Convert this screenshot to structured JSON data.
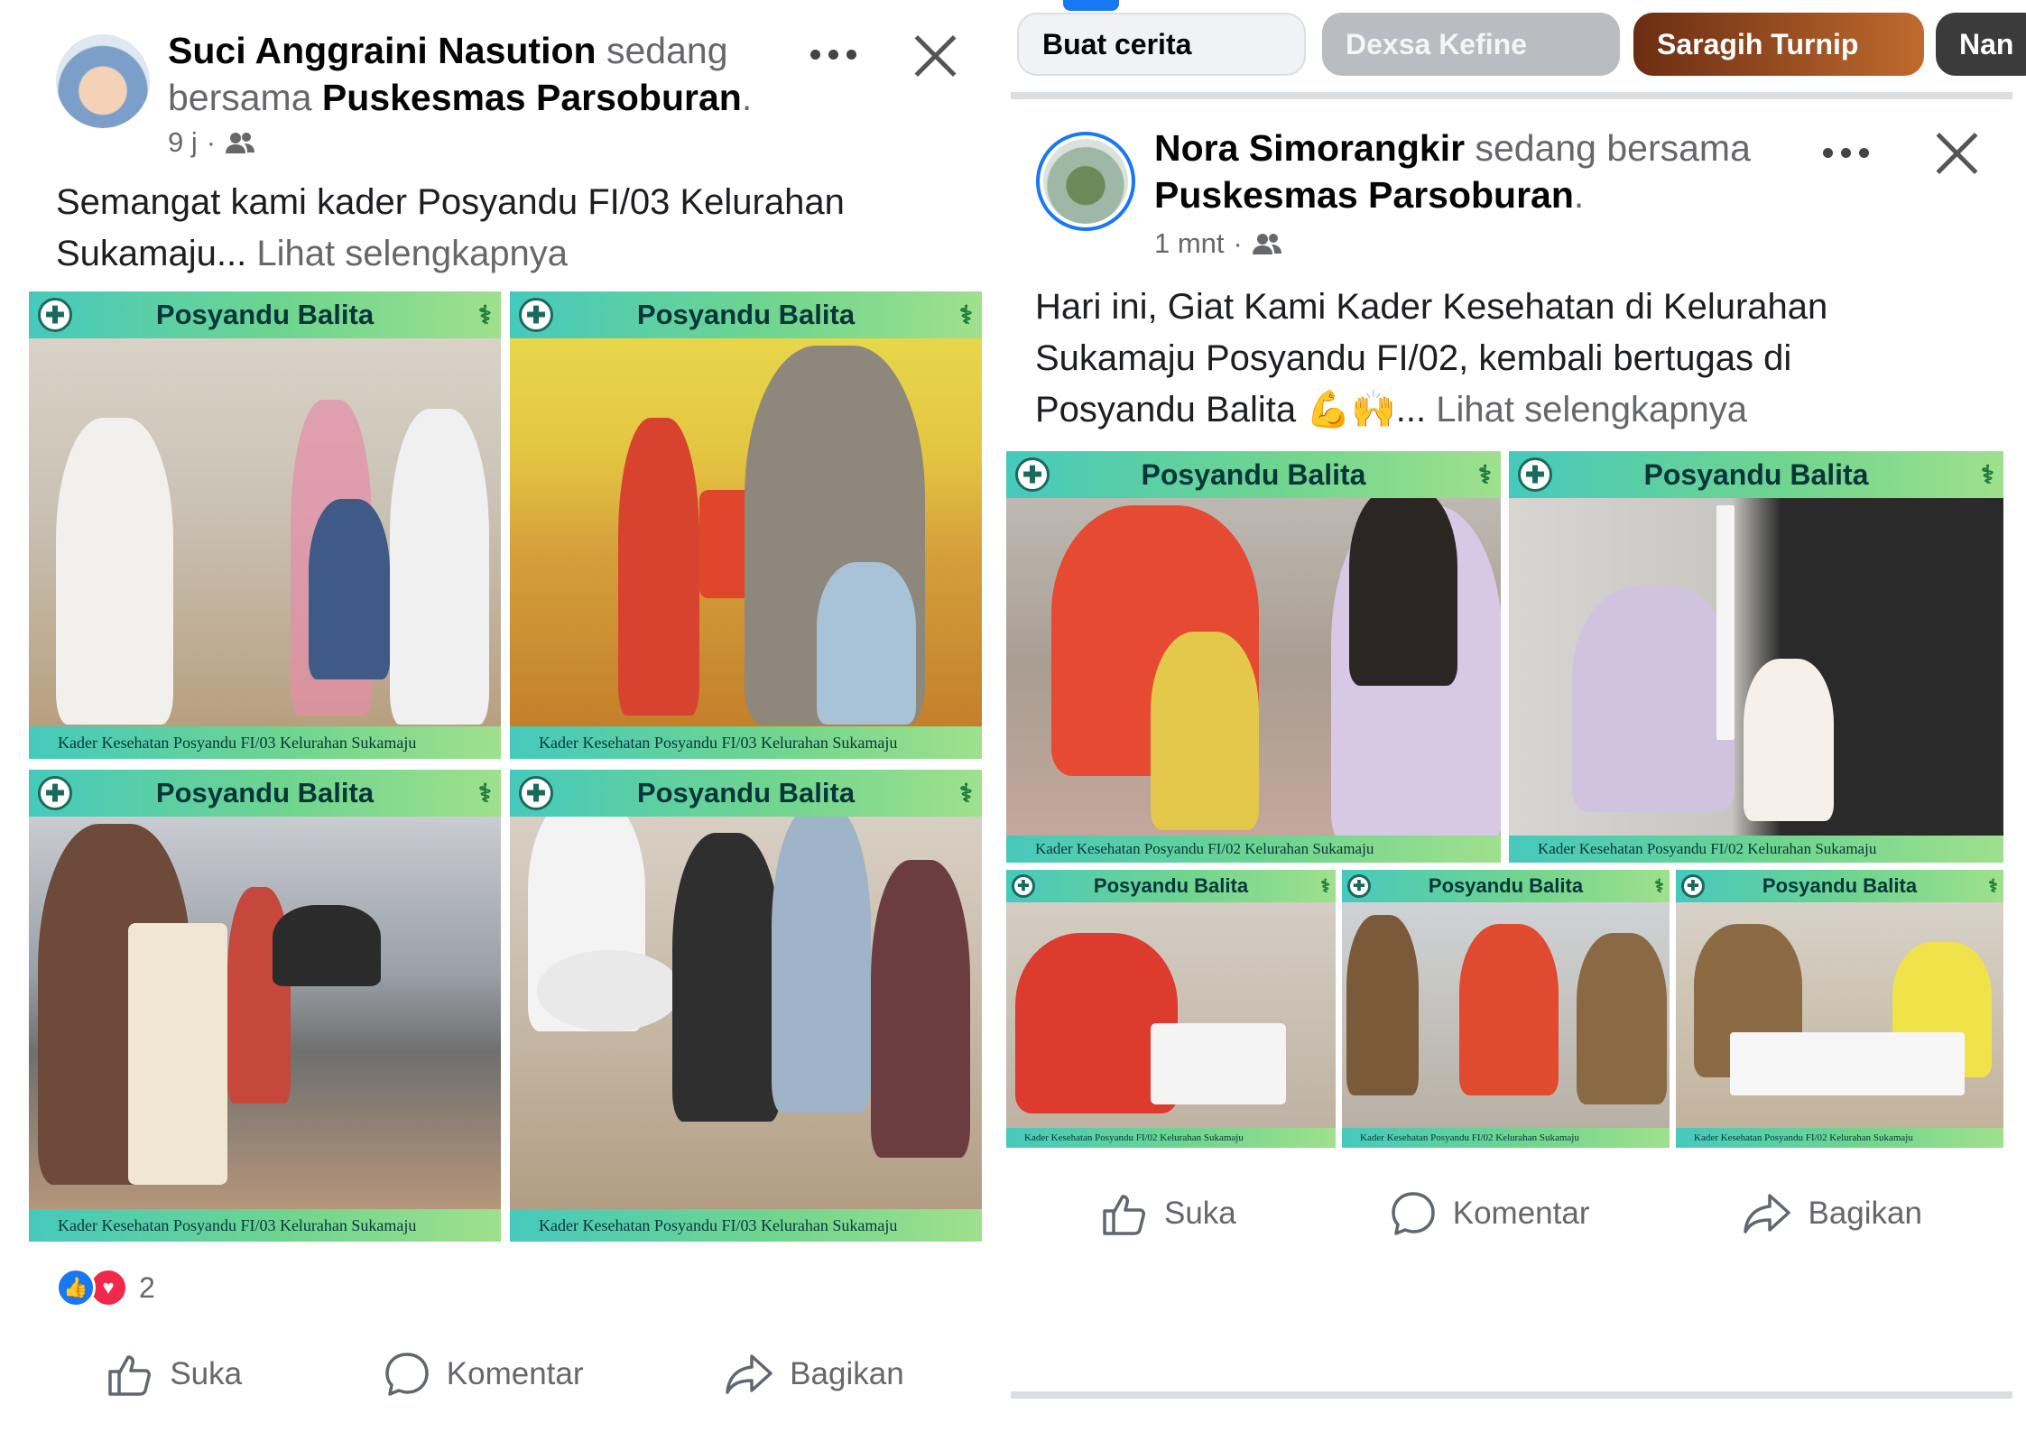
{
  "left_post": {
    "author": "Suci Anggraini Nasution",
    "with_text": "sedang bersama",
    "place": "Puskesmas Parsoburan",
    "time": "9 j",
    "caption": "Semangat kami kader Posyandu FI/03 Kelurahan Sukamaju...",
    "see_more": "Lihat selengkapnya",
    "reaction_count": "2",
    "tiles": [
      {
        "title": "Posyandu Balita",
        "footer": "Kader Kesehatan Posyandu FI/03 Kelurahan Sukamaju"
      },
      {
        "title": "Posyandu Balita",
        "footer": "Kader Kesehatan Posyandu FI/03 Kelurahan Sukamaju"
      },
      {
        "title": "Posyandu Balita",
        "footer": "Kader Kesehatan Posyandu FI/03 Kelurahan Sukamaju"
      },
      {
        "title": "Posyandu Balita",
        "footer": "Kader Kesehatan Posyandu FI/03 Kelurahan Sukamaju"
      }
    ],
    "actions": {
      "like": "Suka",
      "comment": "Komentar",
      "share": "Bagikan"
    }
  },
  "right_post": {
    "stories": [
      "Buat cerita",
      "Dexsa Kefine",
      "Saragih Turnip",
      "Nan"
    ],
    "author": "Nora Simorangkir",
    "with_text": "sedang bersama",
    "place": "Puskesmas Parsoburan",
    "time": "1 mnt",
    "caption": "Hari ini, Giat Kami Kader Kesehatan di Kelurahan Sukamaju Posyandu FI/02, kembali bertugas di Posyandu Balita 💪🙌...",
    "see_more": "Lihat selengkapnya",
    "tiles": [
      {
        "title": "Posyandu Balita",
        "footer": "Kader Kesehatan Posyandu FI/02 Kelurahan Sukamaju"
      },
      {
        "title": "Posyandu Balita",
        "footer": "Kader Kesehatan Posyandu FI/02 Kelurahan Sukamaju"
      },
      {
        "title": "Posyandu Balita",
        "footer": "Kader Kesehatan Posyandu FI/02 Kelurahan Sukamaju"
      },
      {
        "title": "Posyandu Balita",
        "footer": "Kader Kesehatan Posyandu FI/02 Kelurahan Sukamaju"
      },
      {
        "title": "Posyandu Balita",
        "footer": "Kader Kesehatan Posyandu FI/02 Kelurahan Sukamaju"
      }
    ],
    "actions": {
      "like": "Suka",
      "comment": "Komentar",
      "share": "Bagikan"
    }
  },
  "colors": {
    "brand_blue": "#1877f2",
    "band_teal": "#46c9bd",
    "band_green": "#9fe08d",
    "love_red": "#f0284a"
  },
  "icons": [
    "group-audience-icon",
    "more-options-icon",
    "close-icon",
    "like-icon",
    "comment-icon",
    "share-icon",
    "medical-cross-icon"
  ]
}
